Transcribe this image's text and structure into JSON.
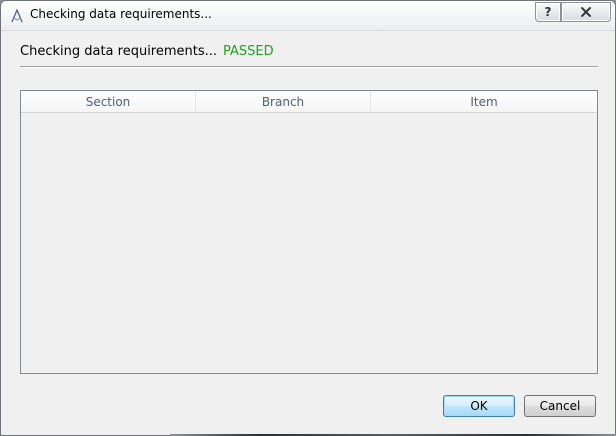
{
  "window": {
    "title": "Checking data requirements...",
    "help_label": "?",
    "close_label": "✕"
  },
  "status": {
    "message": "Checking data requirements...",
    "result": "PASSED",
    "result_color": "#1aa51a"
  },
  "table": {
    "columns": [
      "Section",
      "Branch",
      "Item"
    ],
    "rows": []
  },
  "buttons": {
    "ok_label": "OK",
    "cancel_label": "Cancel"
  }
}
